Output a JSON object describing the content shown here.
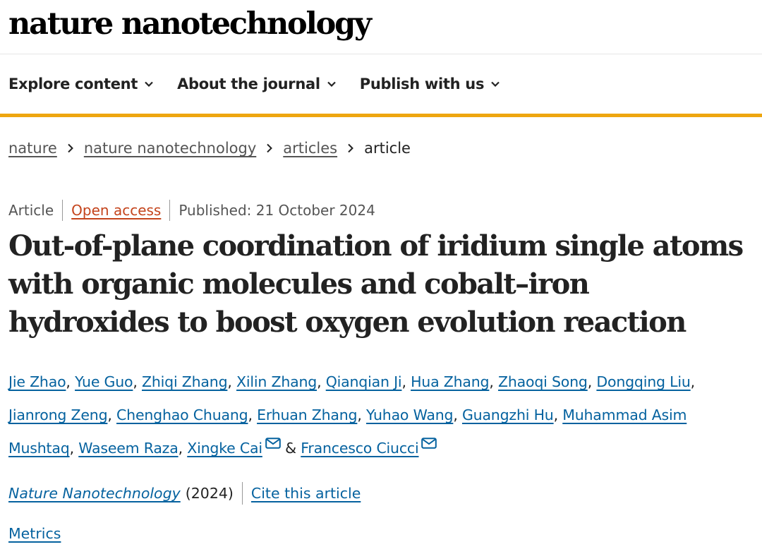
{
  "site": {
    "logo": "nature nanotechnology"
  },
  "nav": {
    "items": [
      {
        "label": "Explore content",
        "icon": "chevron-down-icon"
      },
      {
        "label": "About the journal",
        "icon": "chevron-down-icon"
      },
      {
        "label": "Publish with us",
        "icon": "chevron-down-icon"
      }
    ]
  },
  "breadcrumb": {
    "items": [
      "nature",
      "nature nanotechnology",
      "articles",
      "article"
    ]
  },
  "article": {
    "type": "Article",
    "access": "Open access",
    "published": "Published: 21 October 2024",
    "title": "Out-of-plane coordination of iridium single atoms with organic molecules and cobalt–iron hydroxides to boost oxygen evolution reaction",
    "authors": [
      "Jie Zhao",
      "Yue Guo",
      "Zhiqi Zhang",
      "Xilin Zhang",
      "Qianqian Ji",
      "Hua Zhang",
      "Zhaoqi Song",
      "Dongqing Liu",
      "Jianrong Zeng",
      "Chenghao Chuang",
      "Erhuan Zhang",
      "Yuhao Wang",
      "Guangzhi Hu",
      "Muhammad Asim Mushtaq",
      "Waseem Raza",
      "Xingke Cai",
      "Francesco Ciucci"
    ],
    "journal": "Nature Nanotechnology",
    "year": "(2024)",
    "cite_label": "Cite this article",
    "metrics_label": "Metrics"
  },
  "colors": {
    "accent": "#eea60f",
    "link": "#05629f",
    "open_access": "#c4441c"
  }
}
